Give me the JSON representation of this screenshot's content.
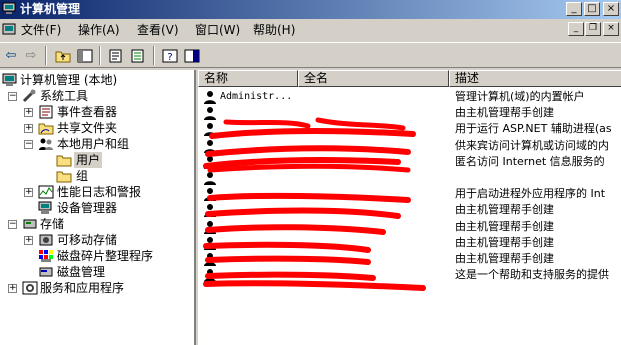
{
  "window": {
    "title": "计算机管理",
    "min_glyph": "_",
    "max_glyph": "□",
    "close_glyph": "×"
  },
  "menu": {
    "items": [
      "文件(F)",
      "操作(A)",
      "查看(V)",
      "窗口(W)",
      "帮助(H)"
    ],
    "mdi_min": "_",
    "mdi_restore": "❐",
    "mdi_close": "×"
  },
  "toolbar": {
    "back": "⇦",
    "forward": "⇨",
    "up": "▣",
    "show_tree": "◫",
    "properties": "▤",
    "export": "▦",
    "help": "?",
    "action": "▥"
  },
  "tree": {
    "root": "计算机管理 (本地)",
    "system_tools": "系统工具",
    "event_viewer": "事件查看器",
    "shared_folders": "共享文件夹",
    "local_users_groups": "本地用户和组",
    "users": "用户",
    "groups": "组",
    "perf_logs": "性能日志和警报",
    "device_manager": "设备管理器",
    "storage": "存储",
    "removable_storage": "可移动存储",
    "defrag": "磁盘碎片整理程序",
    "disk_mgmt": "磁盘管理",
    "services_apps": "服务和应用程序",
    "plus": "+",
    "minus": "−"
  },
  "list": {
    "columns": [
      "名称",
      "全名",
      "描述"
    ],
    "rows": [
      {
        "name": "Administr...",
        "full": "",
        "desc": "管理计算机(域)的内置帐户"
      },
      {
        "name": "",
        "full": "",
        "desc": "由主机管理帮手创建"
      },
      {
        "name": "",
        "full": "",
        "desc": "用于运行 ASP.NET 辅助进程(as"
      },
      {
        "name": "",
        "full": "",
        "desc": "供来宾访问计算机或访问域的内"
      },
      {
        "name": "",
        "full": "",
        "desc": "匿名访问 Internet 信息服务的"
      },
      {
        "name": "",
        "full": "",
        "desc": ""
      },
      {
        "name": "",
        "full": "",
        "desc": "用于启动进程外应用程序的 Int"
      },
      {
        "name": "",
        "full": "",
        "desc": "由主机管理帮手创建"
      },
      {
        "name": "",
        "full": "",
        "desc": "由主机管理帮手创建"
      },
      {
        "name": "",
        "full": "",
        "desc": "由主机管理帮手创建"
      },
      {
        "name": "",
        "full": "",
        "desc": "由主机管理帮手创建"
      },
      {
        "name": "",
        "full": "",
        "desc": "这是一个帮助和支持服务的提供"
      }
    ]
  },
  "colors": {
    "title_start": "#0a246a",
    "title_end": "#a6caf0",
    "face": "#d4d0c8",
    "redaction": "#ff0000"
  }
}
